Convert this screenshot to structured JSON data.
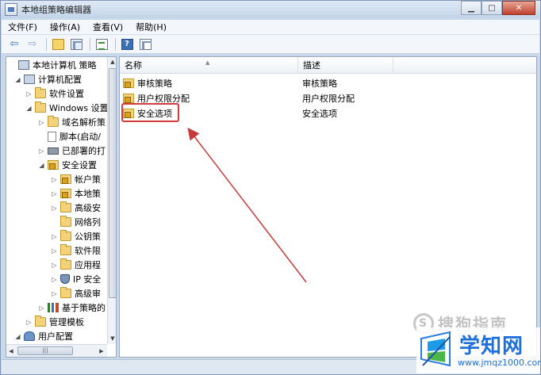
{
  "window": {
    "title": "本地组策略编辑器",
    "minimize_glyph": "▁",
    "maximize_glyph": "□",
    "close_glyph": "✕"
  },
  "menu": [
    "文件(F)",
    "操作(A)",
    "查看(V)",
    "帮助(H)"
  ],
  "toolbar": {
    "back_glyph": "⇦",
    "forward_glyph": "⇨",
    "help_glyph": "?"
  },
  "tree": {
    "items": [
      {
        "label": "本地计算机 策略",
        "icon": "computer-icon",
        "expander": ""
      },
      {
        "label": "计算机配置",
        "icon": "computer-icon",
        "expander": "◢"
      },
      {
        "label": "软件设置",
        "icon": "folder-icon",
        "expander": "▷"
      },
      {
        "label": "Windows 设置",
        "icon": "folder-icon",
        "expander": "◢"
      },
      {
        "label": "域名解析策",
        "icon": "folder-icon",
        "expander": "▷"
      },
      {
        "label": "脚本(启动/",
        "icon": "document-icon",
        "expander": ""
      },
      {
        "label": "已部署的打",
        "icon": "printer-icon",
        "expander": "▷"
      },
      {
        "label": "安全设置",
        "icon": "lock-folder-icon",
        "expander": "◢"
      },
      {
        "label": "帐户策",
        "icon": "lock-folder-icon",
        "expander": "▷"
      },
      {
        "label": "本地策",
        "icon": "lock-folder-icon",
        "expander": "▷"
      },
      {
        "label": "高级安",
        "icon": "folder-icon",
        "expander": "▷"
      },
      {
        "label": "网络列",
        "icon": "folder-icon",
        "expander": ""
      },
      {
        "label": "公钥策",
        "icon": "folder-icon",
        "expander": "▷"
      },
      {
        "label": "软件限",
        "icon": "folder-icon",
        "expander": "▷"
      },
      {
        "label": "应用程",
        "icon": "folder-icon",
        "expander": "▷"
      },
      {
        "label": "IP 安全",
        "icon": "shield-icon",
        "expander": "▷"
      },
      {
        "label": "高级审",
        "icon": "folder-icon",
        "expander": "▷"
      },
      {
        "label": "基于策略的",
        "icon": "chart-icon",
        "expander": "▷"
      },
      {
        "label": "管理模板",
        "icon": "folder-icon",
        "expander": "▷"
      },
      {
        "label": "用户配置",
        "icon": "user-icon",
        "expander": "◢"
      }
    ],
    "scroll_up_glyph": "▲",
    "scroll_down_glyph": "▼",
    "scroll_left_glyph": "◀",
    "scroll_right_glyph": "▶",
    "scroll_grip_glyph": "|||"
  },
  "list": {
    "columns": [
      "名称",
      "描述"
    ],
    "rows": [
      {
        "name": "审核策略",
        "description": "审核策略"
      },
      {
        "name": "用户权限分配",
        "description": "用户权限分配"
      },
      {
        "name": "安全选项",
        "description": "安全选项"
      }
    ]
  },
  "annotation": {
    "highlighted_item": "安全选项",
    "color": "#d23c3c"
  },
  "watermarks": {
    "sogou": "搜狗指南",
    "site_name": "学知网",
    "site_url": "www.jmqz1000.com"
  },
  "colors": {
    "accent": "#1e6fd9",
    "frame": "#c9d9ec"
  }
}
